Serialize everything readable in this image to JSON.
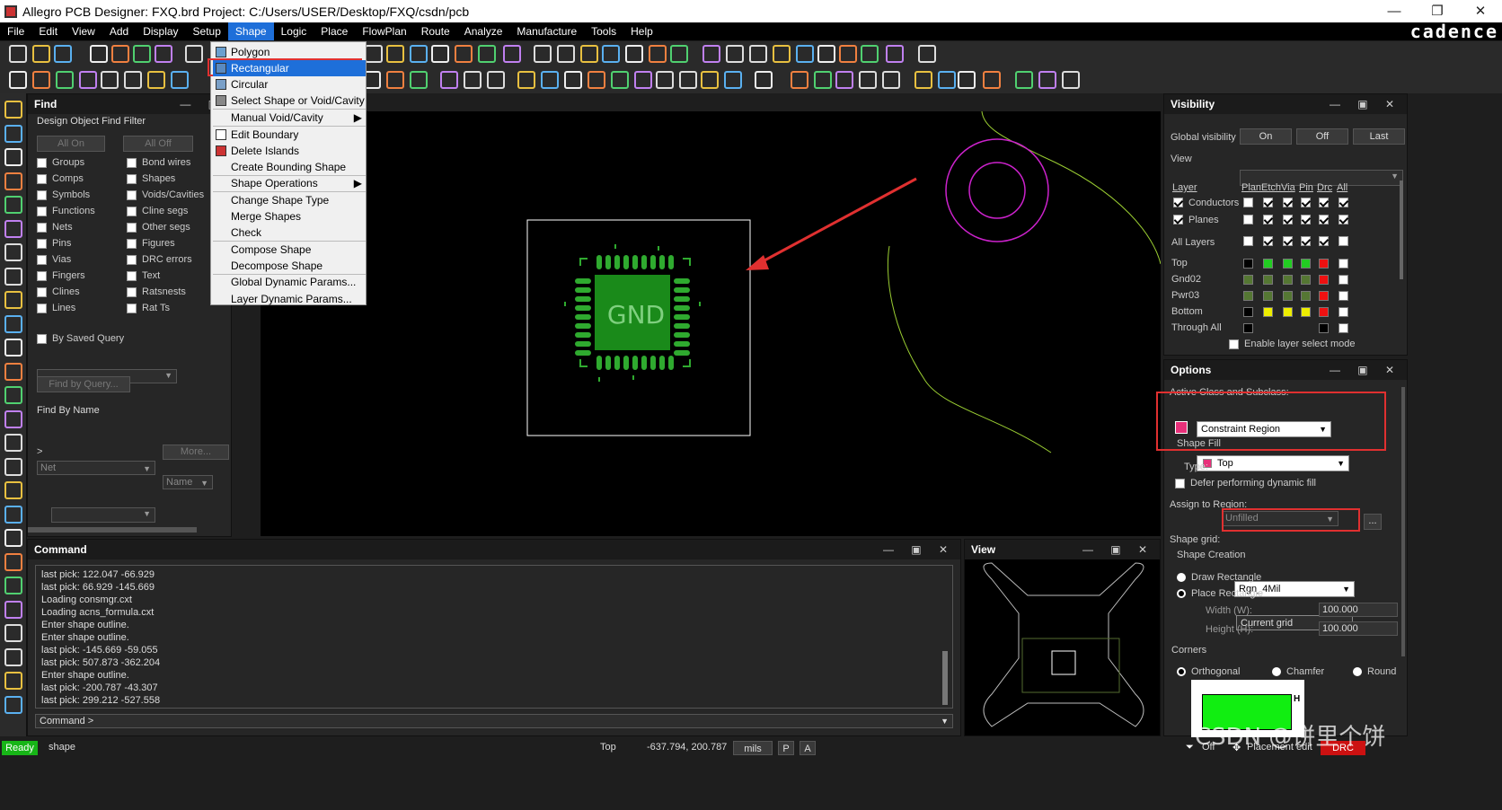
{
  "title": {
    "text": "Allegro PCB Designer: FXQ.brd  Project: C:/Users/USER/Desktop/FXQ/csdn/pcb"
  },
  "window_controls": {
    "minimize": "—",
    "restore": "❐",
    "close": "✕"
  },
  "menu": [
    "File",
    "Edit",
    "View",
    "Add",
    "Display",
    "Setup",
    "Shape",
    "Logic",
    "Place",
    "FlowPlan",
    "Route",
    "Analyze",
    "Manufacture",
    "Tools",
    "Help"
  ],
  "brand": "cadence",
  "shape_menu": {
    "items": [
      "Polygon",
      "Rectangular",
      "Circular",
      "Select Shape or Void/Cavity",
      "Manual Void/Cavity",
      "Edit Boundary",
      "Delete Islands",
      "Create Bounding Shape",
      "Shape Operations",
      "Change Shape Type",
      "Merge Shapes",
      "Check",
      "Compose Shape",
      "Decompose Shape",
      "Global Dynamic Params...",
      "Layer Dynamic Params..."
    ],
    "submenu_arrow": "▶"
  },
  "find": {
    "title": "Find",
    "filter_label": "Design Object Find Filter",
    "all_on": "All On",
    "all_off": "All Off",
    "left_items": [
      "Groups",
      "Comps",
      "Symbols",
      "Functions",
      "Nets",
      "Pins",
      "Vias",
      "Fingers",
      "Clines",
      "Lines"
    ],
    "right_items": [
      "Bond wires",
      "Shapes",
      "Voids/Cavities",
      "Cline segs",
      "Other segs",
      "Figures",
      "DRC errors",
      "Text",
      "Ratsnests",
      "Rat Ts"
    ],
    "saved_query": "By Saved Query",
    "find_by_query": "Find by Query...",
    "find_by_name": "Find By Name",
    "net_combo": "Net",
    "name_combo": "Name",
    "more": "More...",
    "prompt": ">"
  },
  "canvas": {
    "component_label": "GND"
  },
  "command": {
    "title": "Command",
    "lines": [
      "last pick:  122.047 -66.929",
      "last pick:  66.929 -145.669",
      "Loading consmgr.cxt",
      "Loading acns_formula.cxt",
      "Enter shape outline.",
      "Enter shape outline.",
      "last pick:  -145.669 -59.055",
      "last pick:  507.873 -362.204",
      "Enter shape outline.",
      "last pick:  -200.787 -43.307",
      "last pick:  299.212 -527.558"
    ],
    "prompt": "Command >"
  },
  "view_panel": {
    "title": "View"
  },
  "visibility": {
    "title": "Visibility",
    "global_label": "Global visibility",
    "on": "On",
    "off": "Off",
    "last": "Last",
    "view_label": "View",
    "layer_header": "Layer",
    "col_headers": [
      "Plan",
      "Etch",
      "Via",
      "Pin",
      "Drc",
      "All"
    ],
    "group_rows": [
      {
        "name": "Conductors",
        "checked": true
      },
      {
        "name": "Planes",
        "checked": true
      }
    ],
    "all_layers": "All Layers",
    "layers": [
      {
        "name": "Top",
        "colors": [
          "#000000",
          "#22cc22",
          "#22cc22",
          "#22cc22",
          "#ee1111",
          "#ffffff"
        ]
      },
      {
        "name": "Gnd02",
        "colors": [
          "#557733",
          "#557733",
          "#557733",
          "#557733",
          "#ee1111",
          "#ffffff"
        ]
      },
      {
        "name": "Pwr03",
        "colors": [
          "#557733",
          "#557733",
          "#557733",
          "#557733",
          "#ee1111",
          "#ffffff"
        ]
      },
      {
        "name": "Bottom",
        "colors": [
          "#000000",
          "#eeee00",
          "#eeee00",
          "#eeee00",
          "#ee1111",
          "#ffffff"
        ]
      },
      {
        "name": "Through All",
        "colors": [
          "#000000",
          "",
          "",
          "",
          "#000000",
          "#ffffff"
        ]
      }
    ],
    "enable_select": "Enable layer select mode"
  },
  "options": {
    "title": "Options",
    "active_label": "Active Class and Subclass:",
    "class_value": "Constraint Region",
    "subclass_value": "Top",
    "shape_fill": "Shape Fill",
    "type_label": "Type:",
    "type_value": "Unfilled",
    "defer": "Defer performing dynamic fill",
    "assign_label": "Assign to Region:",
    "region_value": "Rgn_4Mil",
    "ellipsis": "...",
    "grid_label": "Shape grid:",
    "grid_value": "Current grid",
    "creation": "Shape Creation",
    "draw_rect": "Draw Rectangle",
    "place_rect": "Place Rectangle",
    "width_label": "Width (W):",
    "width_value": "100.000",
    "height_label": "Height (H):",
    "height_value": "100.000",
    "corners": "Corners",
    "orthogonal": "Orthogonal",
    "chamfer": "Chamfer",
    "round": "Round",
    "preview_dim": "H"
  },
  "status": {
    "ready": "Ready",
    "command": "shape",
    "layer": "Top",
    "coords": "-637.794, 200.787",
    "units": "mils",
    "p": "P",
    "a": "A",
    "off": "Off",
    "mode": "Placement edit",
    "drc": "DRC"
  },
  "watermark": "CSDN @饼里个饼",
  "colors": {
    "selected_menu": "#1e6fd9",
    "annotation_red": "#e03030",
    "component_green": "#1a8a1a",
    "pad_green": "#2faa2f"
  }
}
